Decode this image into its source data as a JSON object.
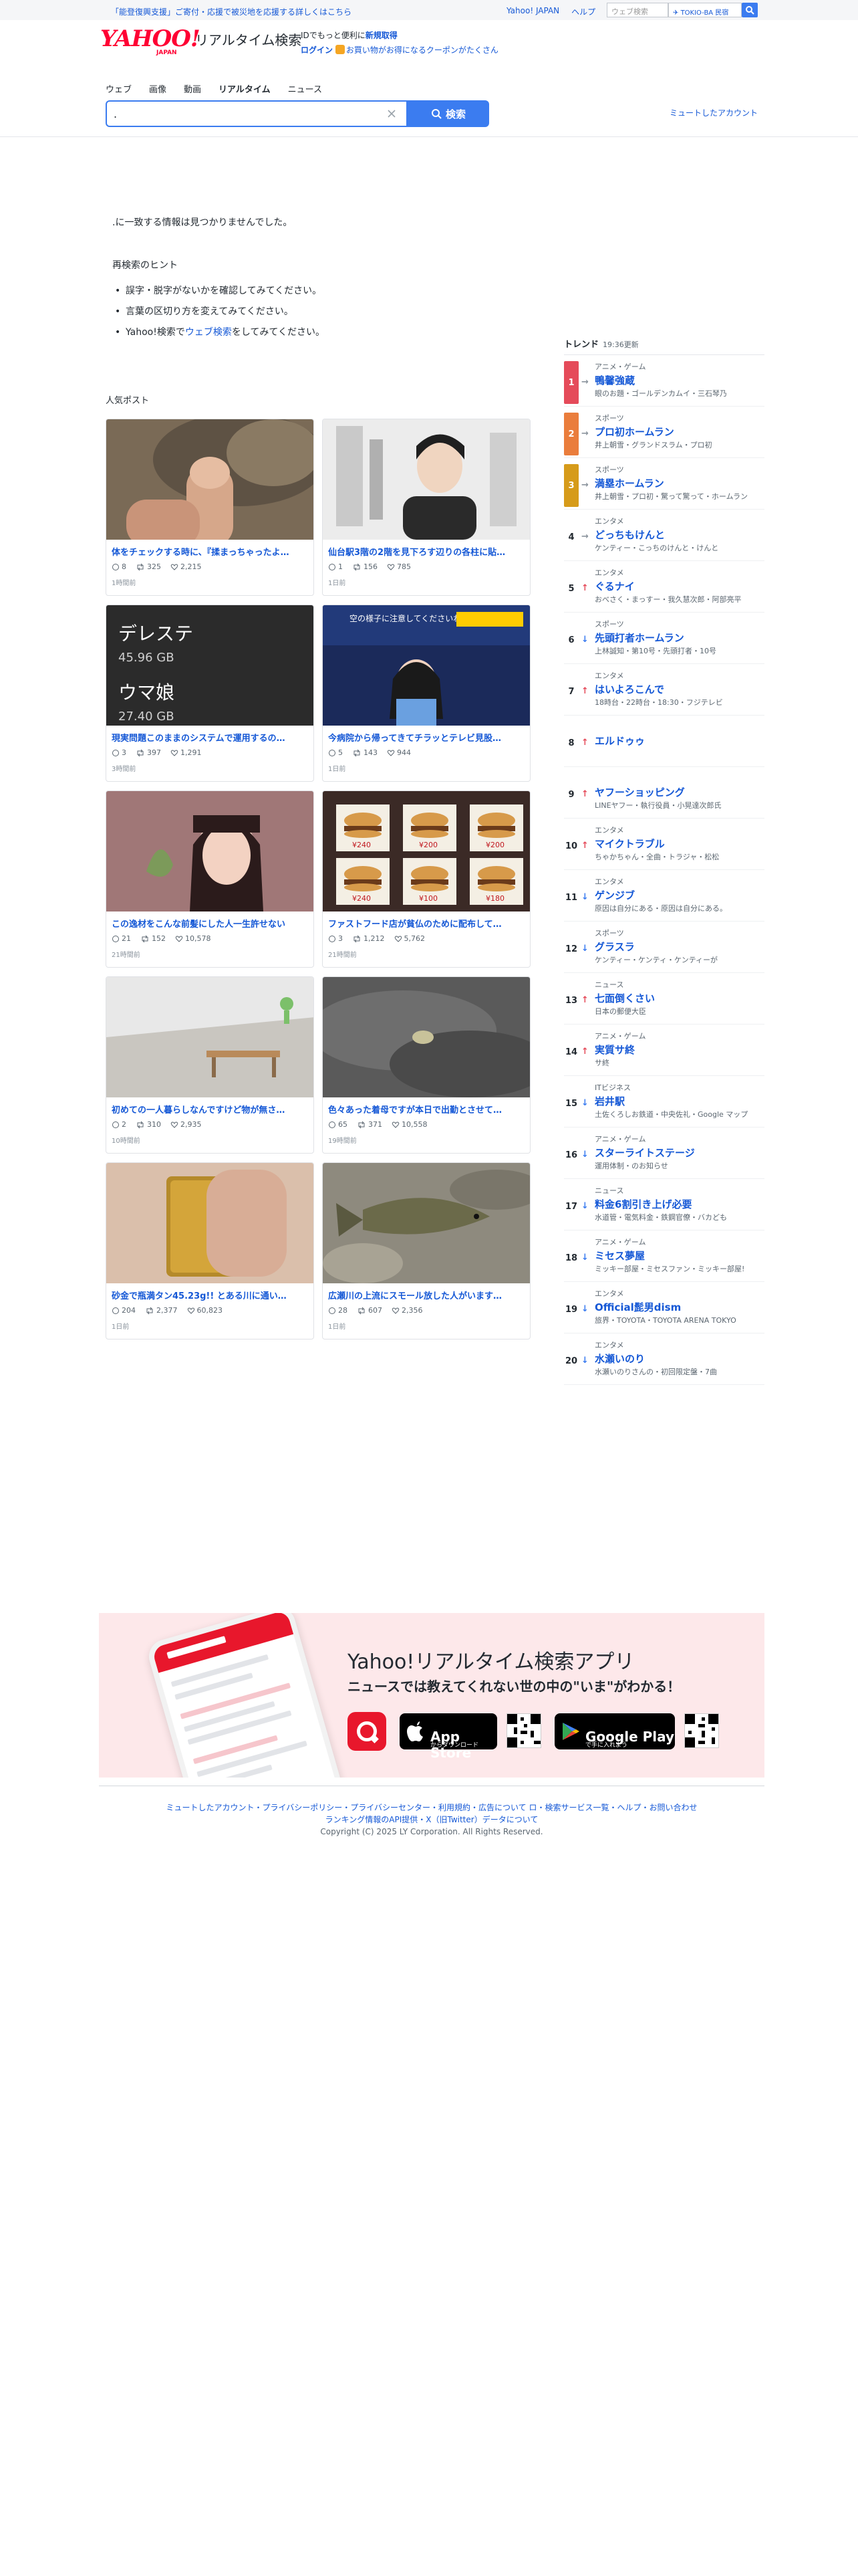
{
  "topbar": {
    "notice": "「能登復興支援」ご寄付・応援で被災地を応援する詳しくはこちら",
    "yahoo_japan": "Yahoo! JAPAN",
    "help": "ヘルプ",
    "mini_search_placeholder": "ウェブ検索",
    "mini_ad": "TOKIO-BA 民宿"
  },
  "header": {
    "logo_text": "YAHOO!",
    "logo_sub": "JAPAN",
    "service_name": "リアルタイム検索",
    "id_line_prefix": "IDでもっと便利に",
    "id_line_link": "新規取得",
    "login": "ログイン",
    "coupon": "お買い物がお得になるクーポンがたくさん"
  },
  "tabs": [
    "ウェブ",
    "画像",
    "動画",
    "リアルタイム",
    "ニュース"
  ],
  "search": {
    "value": ".",
    "button_label": "検索",
    "muted_accounts": "ミュートしたアカウント"
  },
  "noresult": {
    "message": ".に一致する情報は見つかりませんでした。",
    "hint_title": "再検索のヒント",
    "hints": [
      "誤字・脱字がないかを確認してみてください。",
      "言葉の区切り方を変えてみてください。"
    ],
    "hint3_prefix": "Yahoo!検索で",
    "hint3_link": "ウェブ検索",
    "hint3_suffix": "をしてみてください。"
  },
  "popular": {
    "title": "人気ポスト",
    "cards": [
      {
        "text": "体をチェックする時に、『揉まっちゃったよ…",
        "replies": "8",
        "reposts": "325",
        "likes": "2,215",
        "time": "1時間前"
      },
      {
        "text": "仙台駅3階の2階を見下ろす辺りの各柱に貼…",
        "replies": "1",
        "reposts": "156",
        "likes": "785",
        "time": "1日前"
      },
      {
        "text": "現実問題このままのシステムで運用するの…",
        "replies": "3",
        "reposts": "397",
        "likes": "1,291",
        "time": "3時間前"
      },
      {
        "text": "今病院から帰ってきてチラッとテレビ見股…",
        "replies": "5",
        "reposts": "143",
        "likes": "944",
        "time": "1日前"
      },
      {
        "text": "この逸材をこんな前髪にした人一生許せない",
        "replies": "21",
        "reposts": "152",
        "likes": "10,578",
        "time": "21時間前"
      },
      {
        "text": "ファストフード店が貧仏のために配布して…",
        "replies": "3",
        "reposts": "1,212",
        "likes": "5,762",
        "time": "21時間前"
      },
      {
        "text": "初めての一人暮らしなんですけど物が無さ…",
        "replies": "2",
        "reposts": "310",
        "likes": "2,935",
        "time": "10時間前"
      },
      {
        "text": "色々あった着母ですが本日で出勤とさせて…",
        "replies": "65",
        "reposts": "371",
        "likes": "10,558",
        "time": "19時間前"
      },
      {
        "text": "砂金で瓶満タン45.23g!! とある川に通い…",
        "replies": "204",
        "reposts": "2,377",
        "likes": "60,823",
        "time": "1日前"
      },
      {
        "text": "広瀬川の上流にスモール放した人がいます…",
        "replies": "28",
        "reposts": "607",
        "likes": "2,356",
        "time": "1日前"
      }
    ],
    "thumb_texts": {
      "c3_line1": "デレステ",
      "c3_line2": "45.96 GB",
      "c3_line3": "ウマ娘",
      "c3_line4": "27.40 GB",
      "c4_caption": "空の様子に注意してくださいね",
      "c6_prices": [
        "¥240",
        "¥200",
        "¥200",
        "¥240",
        "¥100",
        "¥180"
      ]
    }
  },
  "trends": {
    "title": "トレンド",
    "updated": "19:36更新",
    "items": [
      {
        "rank": "1",
        "dir": "→",
        "cat": "アニメ・ゲーム",
        "word": "鴨馨強蔵",
        "sub": "眼のお題・ゴールデンカムイ・三石琴乃"
      },
      {
        "rank": "2",
        "dir": "→",
        "cat": "スポーツ",
        "word": "プロ初ホームラン",
        "sub": "井上朝雪・グランドスラム・プロ初"
      },
      {
        "rank": "3",
        "dir": "→",
        "cat": "スポーツ",
        "word": "満塁ホームラン",
        "sub": "井上朝雪・プロ初・驚って驚って・ホームラン"
      },
      {
        "rank": "4",
        "dir": "→",
        "cat": "エンタメ",
        "word": "どっちもけんと",
        "sub": "ケンティー・こっちのけんと・けんと"
      },
      {
        "rank": "5",
        "dir": "↑",
        "cat": "エンタメ",
        "word": "ぐるナイ",
        "sub": "おべさく・まっすー・我久慧次郎・阿部亮平"
      },
      {
        "rank": "6",
        "dir": "↓",
        "cat": "スポーツ",
        "word": "先頭打者ホームラン",
        "sub": "上林誠知・第10号・先頭打者・10号"
      },
      {
        "rank": "7",
        "dir": "↑",
        "cat": "エンタメ",
        "word": "はいよろこんで",
        "sub": "18時台・22時台・18:30・フジテレビ"
      },
      {
        "rank": "8",
        "dir": "↑",
        "cat": "",
        "word": "エルドゥゥ",
        "sub": ""
      },
      {
        "rank": "9",
        "dir": "↑",
        "cat": "",
        "word": "ヤフーショッピング",
        "sub": "LINEヤフー・執行役員・小晃達次郎氏"
      },
      {
        "rank": "10",
        "dir": "↑",
        "cat": "エンタメ",
        "word": "マイクトラブル",
        "sub": "ちゃかちゃん・全曲・トラジャ・松松"
      },
      {
        "rank": "11",
        "dir": "↓",
        "cat": "エンタメ",
        "word": "ゲンジブ",
        "sub": "原因は自分にある・原因は自分にある。"
      },
      {
        "rank": "12",
        "dir": "↓",
        "cat": "スポーツ",
        "word": "グラスラ",
        "sub": "ケンティー・ケンティ・ケンティーが"
      },
      {
        "rank": "13",
        "dir": "↑",
        "cat": "ニュース",
        "word": "七面倒くさい",
        "sub": "日本の郵便大臣"
      },
      {
        "rank": "14",
        "dir": "↑",
        "cat": "アニメ・ゲーム",
        "word": "実質サ終",
        "sub": "サ終"
      },
      {
        "rank": "15",
        "dir": "↓",
        "cat": "ITビジネス",
        "word": "岩井駅",
        "sub": "土佐くろしお鉄道・中央佐礼・Google マップ"
      },
      {
        "rank": "16",
        "dir": "↓",
        "cat": "アニメ・ゲーム",
        "word": "スターライトステージ",
        "sub": "運用体制・のお知らせ"
      },
      {
        "rank": "17",
        "dir": "↓",
        "cat": "ニュース",
        "word": "料金6割引き上げ必要",
        "sub": "水道管・電気料金・鉄鋼官僚・バカども"
      },
      {
        "rank": "18",
        "dir": "↓",
        "cat": "アニメ・ゲーム",
        "word": "ミセス夢屋",
        "sub": "ミッキー部屋・ミセスファン・ミッキー部屋!"
      },
      {
        "rank": "19",
        "dir": "↓",
        "cat": "エンタメ",
        "word": "Official髭男dism",
        "sub": "旅界・TOYOTA・TOYOTA ARENA TOKYO"
      },
      {
        "rank": "20",
        "dir": "↓",
        "cat": "エンタメ",
        "word": "水瀬いのり",
        "sub": "水瀬いのりさんの・初回限定盤・7曲"
      }
    ]
  },
  "banner": {
    "title": "Yahoo!リアルタイム検索アプリ",
    "subtitle": "ニュースでは教えてくれない世の中の\"いま\"がわかる！",
    "appstore_small": "App Storeからダウンロード",
    "appstore_big": "App Store",
    "googleplay_small": "で手に入れよう",
    "googleplay_big": "Google Play",
    "apple_small": "からダウンロード"
  },
  "footer": {
    "links": "ミュートしたアカウント・プライバシーポリシー・プライバシーセンター・利用規約・広告について ロ・検索サービス一覧・ヘルプ・お問い合わせ",
    "links2": "ランキング情報のAPI提供・X（旧Twitter）データについて",
    "copyright": "Copyright (C) 2025 LY Corporation. All Rights Reserved."
  },
  "colors": {
    "accent": "#3b7cf0",
    "link": "#1558d6",
    "rank1": "#e54b5a",
    "rank2": "#ea7d3c",
    "rank3": "#d69b1a",
    "up": "#e54b5a",
    "down": "#3b7cf0",
    "flat": "#8a939c"
  }
}
